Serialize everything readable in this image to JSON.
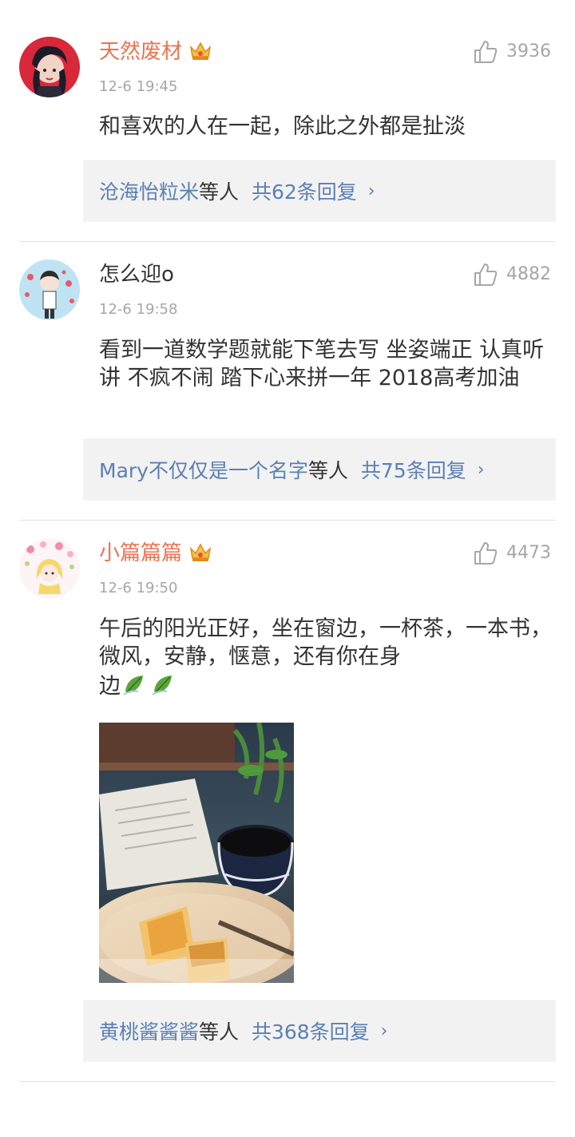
{
  "comments": [
    {
      "username": "天然废材",
      "vip": true,
      "time": "12-6 19:45",
      "likes": "3936",
      "text": "和喜欢的人在一起，除此之外都是扯淡",
      "replies": {
        "names": "沧海怡粒米",
        "suffix": "等人",
        "count": "共62条回复"
      }
    },
    {
      "username": "怎么迎o",
      "vip": false,
      "time": "12-6 19:58",
      "likes": "4882",
      "text": "看到一道数学题就能下笔去写 坐姿端正 认真听讲 不疯不闹 踏下心来拼一年 2018高考加油",
      "replies": {
        "names": "Mary不仅仅是一个名字",
        "suffix": "等人",
        "count": "共75条回复"
      }
    },
    {
      "username": "小篇篇篇",
      "vip": true,
      "time": "12-6 19:50",
      "likes": "4473",
      "text_line1": "午后的阳光正好，坐在窗边，一杯茶，一本书，微风，安静，惬意，还有你在身",
      "text_line2": "边",
      "emoji": "leaf-emoji",
      "replies": {
        "names": "黄桃酱酱酱",
        "suffix": "等人",
        "count": "共368条回复"
      }
    }
  ],
  "icons": {
    "like": "thumbs-up-icon",
    "crown": "vip-crown-icon",
    "chevron": "›"
  },
  "colors": {
    "vip_name": "#eb7350",
    "link": "#5b80b3",
    "meta": "#a6a6a6",
    "reply_bg": "#f2f2f2"
  }
}
